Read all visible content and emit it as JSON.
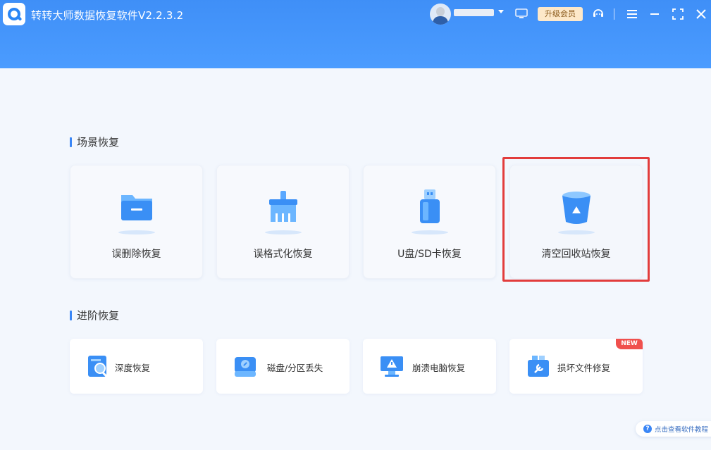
{
  "app": {
    "title": "转转大师数据恢复软件V2.2.3.2"
  },
  "header": {
    "vip_label": "升级会员",
    "icons": [
      "monitor-icon",
      "support-icon",
      "menu-icon",
      "minimize-icon",
      "maximize-icon",
      "close-icon"
    ]
  },
  "sections": {
    "scene": {
      "heading": "场景恢复",
      "cards": [
        {
          "label": "误删除恢复",
          "icon": "folder-icon"
        },
        {
          "label": "误格式化恢复",
          "icon": "broom-icon"
        },
        {
          "label": "U盘/SD卡恢复",
          "icon": "usb-drive-icon"
        },
        {
          "label": "清空回收站恢复",
          "icon": "recycle-bin-icon"
        }
      ]
    },
    "advanced": {
      "heading": "进阶恢复",
      "cards": [
        {
          "label": "深度恢复",
          "icon": "deep-scan-icon"
        },
        {
          "label": "磁盘/分区丢失",
          "icon": "disk-icon"
        },
        {
          "label": "崩溃电脑恢复",
          "icon": "crashed-pc-icon"
        },
        {
          "label": "损坏文件修复",
          "icon": "file-repair-icon",
          "badge": "NEW"
        }
      ]
    }
  },
  "footer": {
    "help_label": "点击查看软件教程"
  },
  "colors": {
    "header_blue": "#4b9cff",
    "accent_blue": "#3a86f6",
    "highlight_red": "#e23c3c",
    "badge_red": "#f0504d",
    "vip_gold": "#fde8c9"
  }
}
